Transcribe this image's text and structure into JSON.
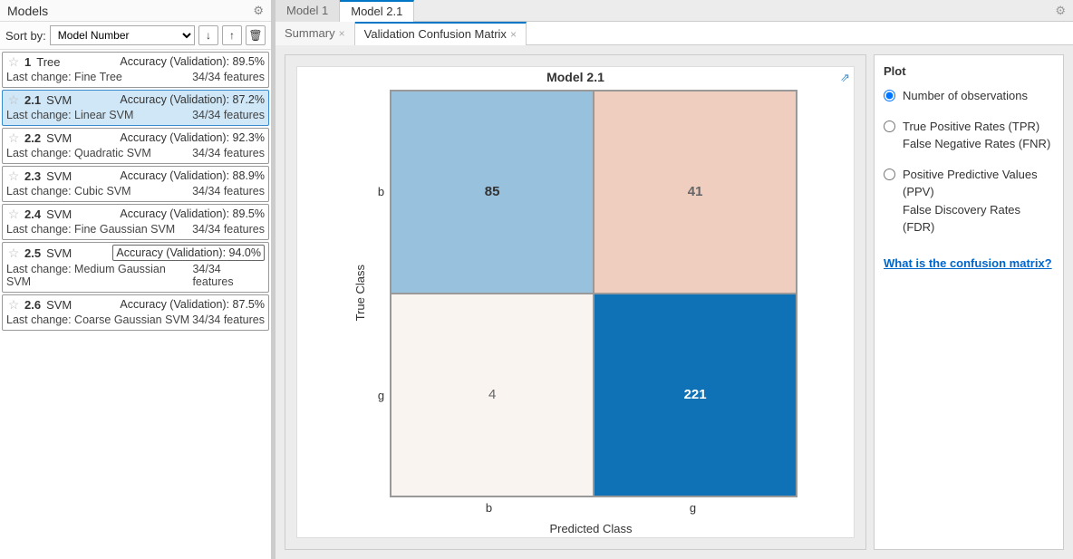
{
  "sidebar": {
    "title": "Models",
    "sort_label": "Sort by:",
    "sort_value": "Model Number",
    "icons": {
      "up": "↑",
      "down": "↓",
      "trash": "🗑"
    }
  },
  "models": [
    {
      "num": "1",
      "type": "Tree",
      "acc_label": "Accuracy (Validation):",
      "acc": "89.5%",
      "lc_label": "Last change:",
      "lc": "Fine Tree",
      "feat": "34/34 features",
      "selected": false,
      "boxed": false
    },
    {
      "num": "2.1",
      "type": "SVM",
      "acc_label": "Accuracy (Validation):",
      "acc": "87.2%",
      "lc_label": "Last change:",
      "lc": "Linear SVM",
      "feat": "34/34 features",
      "selected": true,
      "boxed": false
    },
    {
      "num": "2.2",
      "type": "SVM",
      "acc_label": "Accuracy (Validation):",
      "acc": "92.3%",
      "lc_label": "Last change:",
      "lc": "Quadratic SVM",
      "feat": "34/34 features",
      "selected": false,
      "boxed": false
    },
    {
      "num": "2.3",
      "type": "SVM",
      "acc_label": "Accuracy (Validation):",
      "acc": "88.9%",
      "lc_label": "Last change:",
      "lc": "Cubic SVM",
      "feat": "34/34 features",
      "selected": false,
      "boxed": false
    },
    {
      "num": "2.4",
      "type": "SVM",
      "acc_label": "Accuracy (Validation):",
      "acc": "89.5%",
      "lc_label": "Last change:",
      "lc": "Fine Gaussian SVM",
      "feat": "34/34 features",
      "selected": false,
      "boxed": false
    },
    {
      "num": "2.5",
      "type": "SVM",
      "acc_label": "Accuracy (Validation):",
      "acc": "94.0%",
      "lc_label": "Last change:",
      "lc": "Medium Gaussian SVM",
      "feat": "34/34 features",
      "selected": false,
      "boxed": true
    },
    {
      "num": "2.6",
      "type": "SVM",
      "acc_label": "Accuracy (Validation):",
      "acc": "87.5%",
      "lc_label": "Last change:",
      "lc": "Coarse Gaussian SVM",
      "feat": "34/34 features",
      "selected": false,
      "boxed": false
    }
  ],
  "top_tabs": [
    {
      "label": "Model 1",
      "active": false
    },
    {
      "label": "Model 2.1",
      "active": true
    }
  ],
  "sub_tabs": [
    {
      "label": "Summary",
      "active": false,
      "closable": true
    },
    {
      "label": "Validation Confusion Matrix",
      "active": true,
      "closable": true
    }
  ],
  "chart": {
    "title": "Model 2.1",
    "y_label": "True Class",
    "x_label": "Predicted Class",
    "y_ticks": [
      "b",
      "g"
    ],
    "x_ticks": [
      "b",
      "g"
    ]
  },
  "chart_data": {
    "type": "heatmap",
    "title": "Model 2.1",
    "xlabel": "Predicted Class",
    "ylabel": "True Class",
    "categories_x": [
      "b",
      "g"
    ],
    "categories_y": [
      "b",
      "g"
    ],
    "values": [
      [
        85,
        41
      ],
      [
        4,
        221
      ]
    ]
  },
  "plot_panel": {
    "title": "Plot",
    "options": [
      {
        "lines": [
          "Number of observations"
        ],
        "checked": true
      },
      {
        "lines": [
          "True Positive Rates (TPR)",
          "False Negative Rates (FNR)"
        ],
        "checked": false
      },
      {
        "lines": [
          "Positive Predictive Values (PPV)",
          "False Discovery Rates (FDR)"
        ],
        "checked": false
      }
    ],
    "help": "What is the confusion matrix?"
  }
}
